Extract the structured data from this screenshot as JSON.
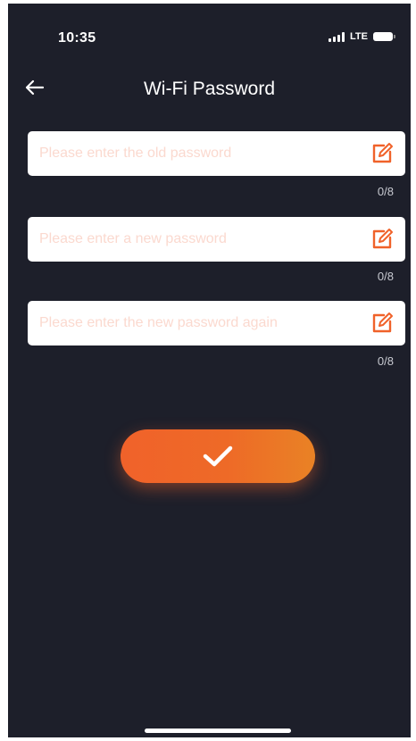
{
  "status_bar": {
    "time": "10:35",
    "network": "LTE"
  },
  "header": {
    "title": "Wi-Fi Password",
    "back_icon": "arrow-left-icon"
  },
  "fields": [
    {
      "placeholder": "Please enter the old password",
      "value": "",
      "counter": "0/8",
      "icon": "edit-icon"
    },
    {
      "placeholder": "Please enter a new password",
      "value": "",
      "counter": "0/8",
      "icon": "edit-icon"
    },
    {
      "placeholder": "Please enter the new password again",
      "value": "",
      "counter": "0/8",
      "icon": "edit-icon"
    }
  ],
  "confirm": {
    "icon": "checkmark-icon"
  },
  "colors": {
    "background": "#1d1f2a",
    "accent": "#f0622a",
    "placeholder": "#fbd9cf"
  }
}
